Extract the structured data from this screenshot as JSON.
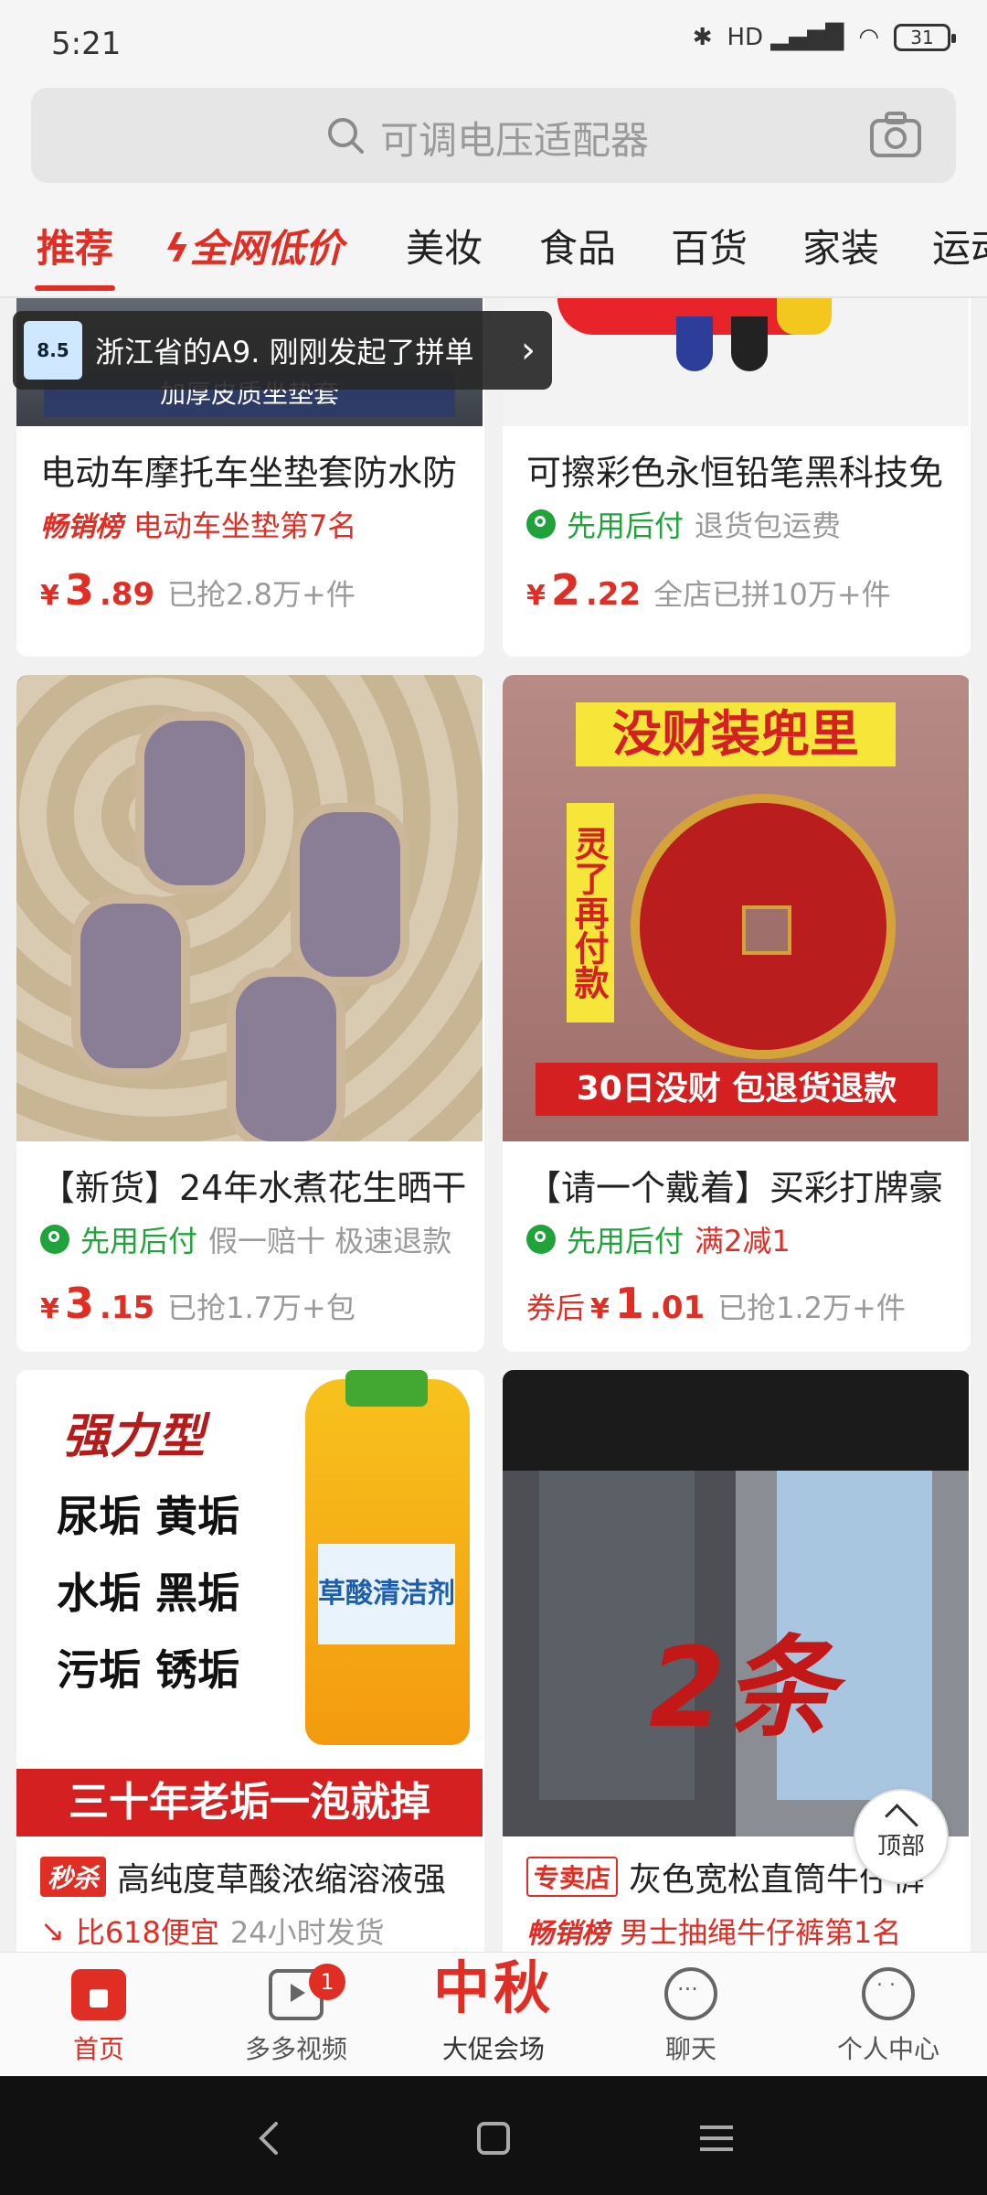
{
  "status": {
    "time": "5:21",
    "battery": "31",
    "network": "HD"
  },
  "search": {
    "placeholder": "可调电压适配器"
  },
  "tabs": [
    {
      "label": "推荐",
      "active": true
    },
    {
      "label": "全网低价",
      "special": true
    },
    {
      "label": "美妆"
    },
    {
      "label": "食品"
    },
    {
      "label": "百货"
    },
    {
      "label": "家装"
    },
    {
      "label": "运动"
    }
  ],
  "promo_toast": {
    "text": "浙江省的A9. 刚刚发起了拼单",
    "thumb_text": "8.5"
  },
  "products": [
    {
      "title": "电动车摩托车坐垫套防水防",
      "image_caption": "加厚皮质坐垫套",
      "badge": "畅销榜",
      "rank_text": "电动车坐垫第7名",
      "price_prefix": "",
      "price_int": "3",
      "price_dec": ".89",
      "sold": "已抢2.8万+件"
    },
    {
      "title": "可擦彩色永恒铅笔黑科技免",
      "tag1": "先用后付",
      "tag2": "退货包运费",
      "price_prefix": "",
      "price_int": "2",
      "price_dec": ".22",
      "sold": "全店已拼10万+件"
    },
    {
      "title": "【新货】24年水煮花生晒干",
      "tag1": "先用后付",
      "tag2": "假一赔十  极速退款",
      "price_prefix": "",
      "price_int": "3",
      "price_dec": ".15",
      "sold": "已抢1.7万+包"
    },
    {
      "title": "【请一个戴着】买彩打牌豪",
      "image_top": "没财装兜里",
      "image_side": "灵了再付款",
      "image_bottom": "30日没财 包退货退款",
      "tag1": "先用后付",
      "tag2": "满2减1",
      "price_prefix": "券后",
      "price_int": "1",
      "price_dec": ".01",
      "sold": "已抢1.2万+件"
    },
    {
      "title": "高纯度草酸浓缩溶液强",
      "image_head": "强力型",
      "image_lines": [
        "尿垢  黄垢",
        "水垢  黑垢",
        "污垢  锈垢"
      ],
      "image_bottom": "三十年老垢一泡就掉",
      "image_label": "草酸清洁剂",
      "badge": "秒杀",
      "tag1": "比618便宜",
      "tag2": "24小时发货"
    },
    {
      "title": "灰色宽松直筒牛仔裤",
      "image_text": "2条",
      "badge": "专卖店",
      "rank_badge": "畅销榜",
      "rank_text": "男士抽绳牛仔裤第1名"
    }
  ],
  "back_to_top": "顶部",
  "bottom_nav": [
    {
      "label": "首页",
      "icon": "home-icon",
      "active": true
    },
    {
      "label": "多多视频",
      "icon": "video-icon",
      "badge": "1"
    },
    {
      "label": "大促会场",
      "icon": "festival-icon",
      "icon_text": "中秋"
    },
    {
      "label": "聊天",
      "icon": "chat-icon"
    },
    {
      "label": "个人中心",
      "icon": "user-icon"
    }
  ],
  "colors": {
    "accent": "#e02e24",
    "green": "#1fa33a",
    "muted": "#9a9a9a"
  }
}
